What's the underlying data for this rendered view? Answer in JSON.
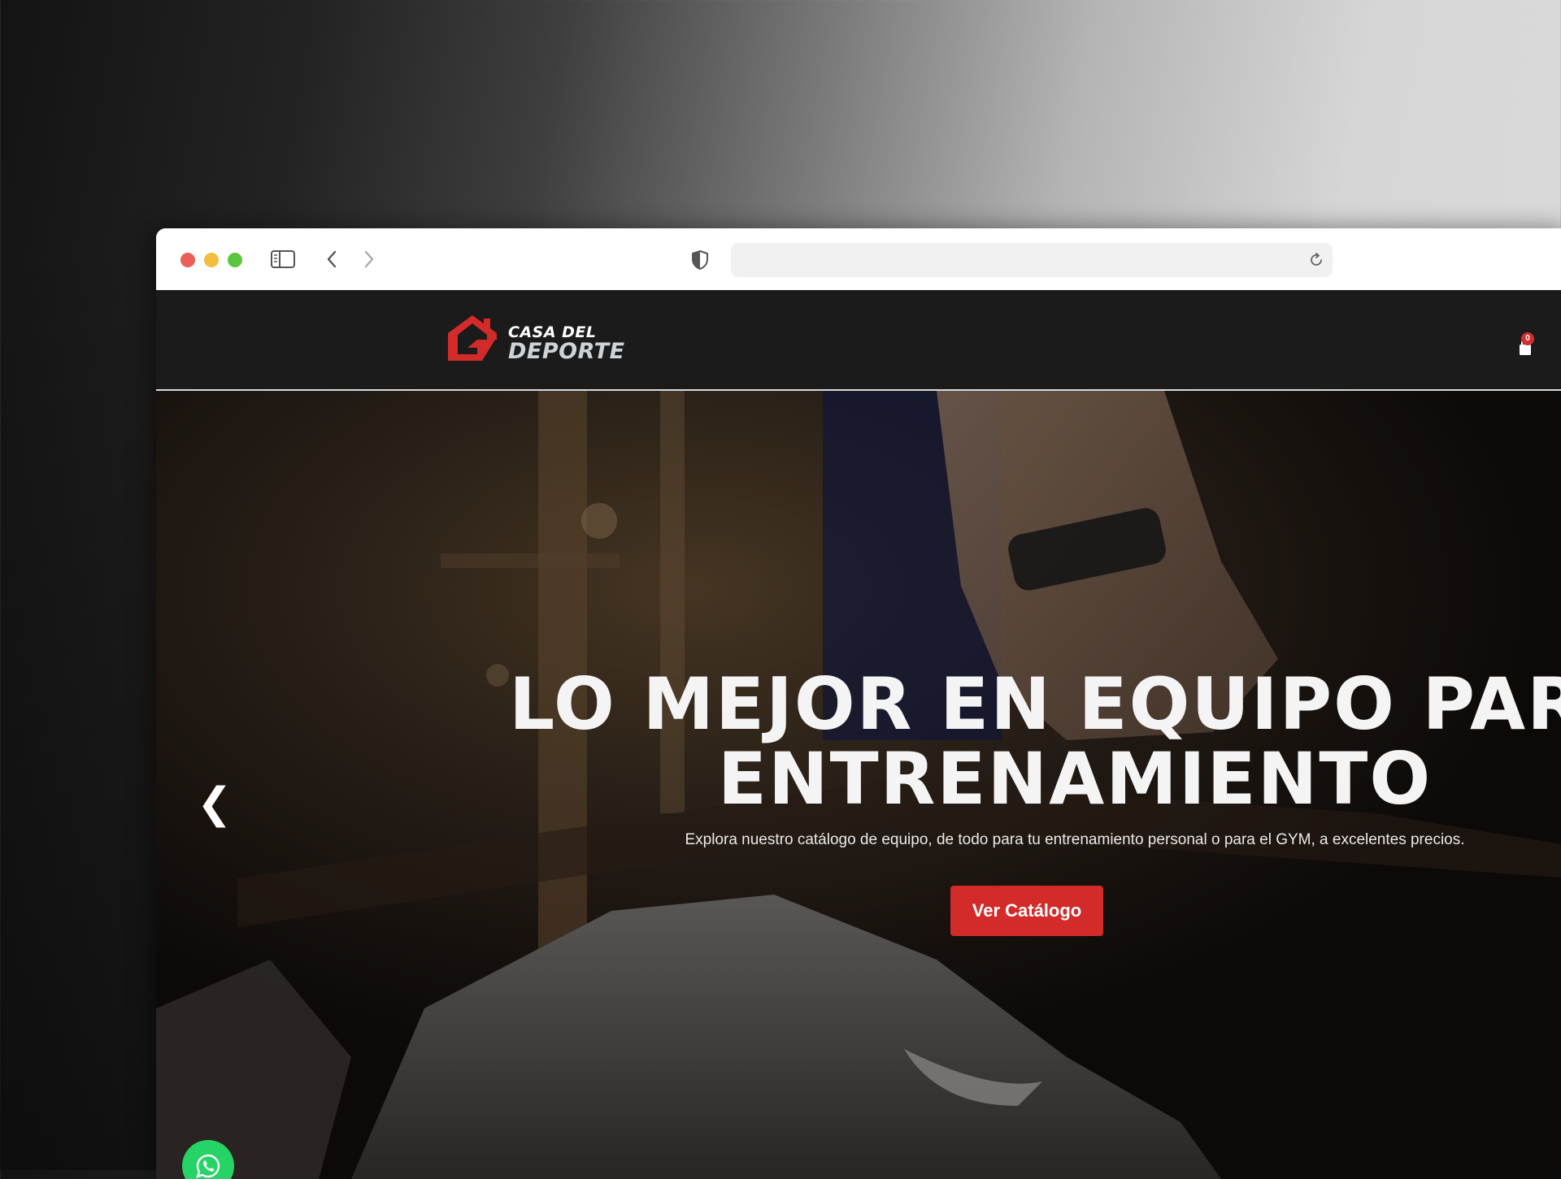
{
  "browser": {
    "address_url": ""
  },
  "site": {
    "logo": {
      "line1": "CASA DEL",
      "line2": "DEPORTE"
    },
    "cart_count": "0"
  },
  "hero": {
    "title_line1": "LO MEJOR EN EQUIPO PARA",
    "title_line2": "ENTRENAMIENTO",
    "subtitle": "Explora nuestro catálogo de equipo, de todo para tu entrenamiento personal o para el GYM, a excelentes precios.",
    "cta_label": "Ver Catálogo",
    "prev_arrow": "❮"
  },
  "colors": {
    "accent": "#d32a2a",
    "header_bg": "#1c1b1b",
    "whatsapp": "#25d366"
  },
  "icons": [
    "sidebar-icon",
    "back-chevron-icon",
    "forward-chevron-icon",
    "privacy-shield-icon",
    "reload-icon",
    "logo-house-icon",
    "cart-bag-icon",
    "whatsapp-icon"
  ]
}
